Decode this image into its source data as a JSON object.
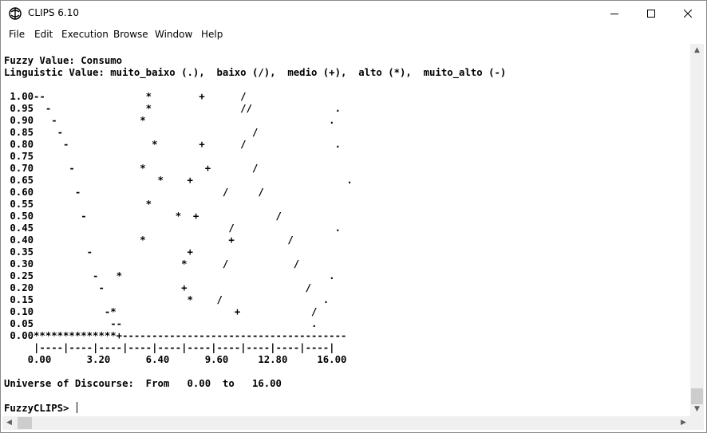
{
  "window": {
    "title": "CLIPS 6.10"
  },
  "menu": [
    "File",
    "Edit",
    "Execution",
    "Browse",
    "Window",
    "Help"
  ],
  "console": {
    "lines": [
      "Fuzzy Value: Consumo",
      "Linguistic Value: muito_baixo (.),  baixo (/),  medio (+),  alto (*),  muito_alto (-)",
      "",
      " 1.00--                 *        +      /",
      " 0.95  -                *               //              .",
      " 0.90   -              *                               .",
      " 0.85    -                                /",
      " 0.80     -              *       +      /               .",
      " 0.75",
      " 0.70      -           *          +       /",
      " 0.65                     *    +                          .",
      " 0.60       -                        /     /",
      " 0.55                   *",
      " 0.50        -               *  +             /",
      " 0.45                                 /                 .",
      " 0.40                  *              +         /",
      " 0.35         -                +",
      " 0.30                         *      /           /",
      " 0.25          -   *                                   .",
      " 0.20           -             +                    /",
      " 0.15                          *    /                 .",
      " 0.10            -*                    +            /",
      " 0.05             --                                .",
      " 0.00**************+--------------------------------------",
      "     |----|----|----|----|----|----|----|----|----|----|",
      "    0.00      3.20      6.40      9.60     12.80     16.00",
      "",
      "Universe of Discourse:  From   0.00  to   16.00",
      "",
      "FuzzyCLIPS> "
    ]
  },
  "scroll": {
    "vertical_up": "▲",
    "vertical_down": "▼",
    "horizontal_left": "◀",
    "horizontal_right": "▶"
  }
}
